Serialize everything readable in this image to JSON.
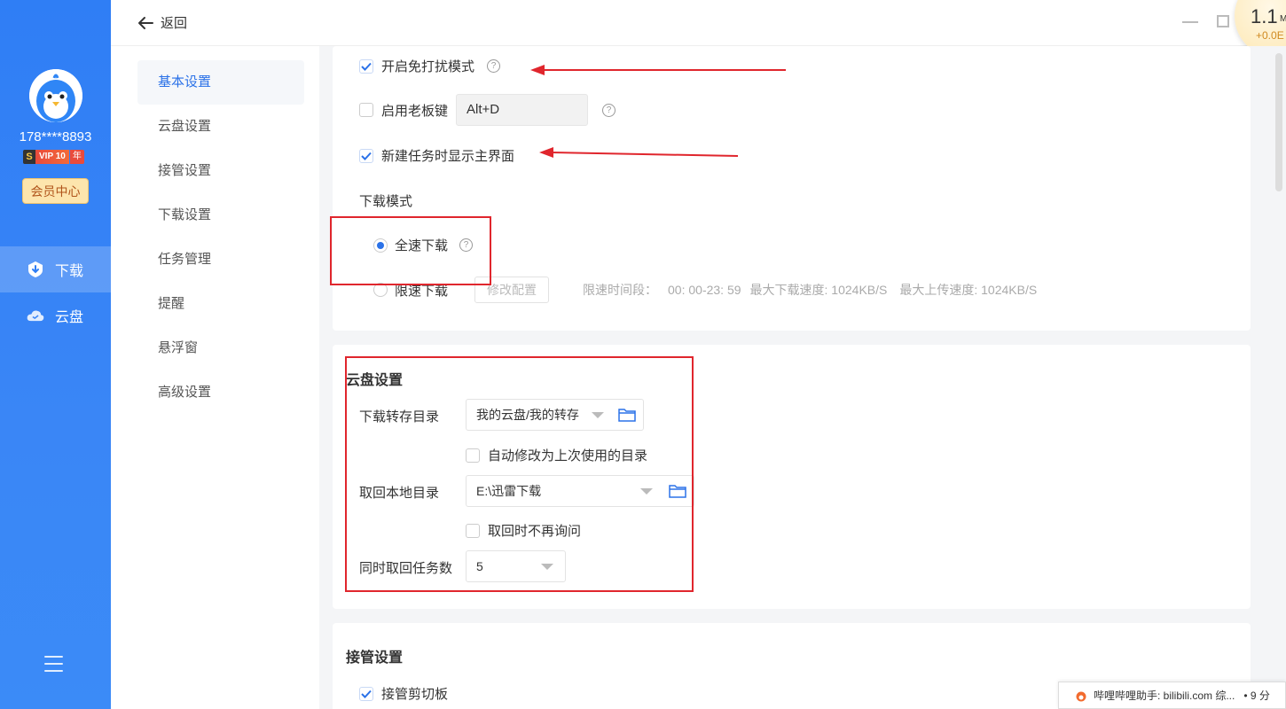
{
  "sidebar": {
    "username": "178****8893",
    "vip_prefix": "S",
    "vip_label": "VIP 10",
    "vip_suffix": "年",
    "member_center": "会员中心",
    "nav": [
      {
        "label": "下载",
        "icon": "download-shield-icon",
        "active": true
      },
      {
        "label": "云盘",
        "icon": "cloud-icon",
        "active": false
      }
    ]
  },
  "topbar": {
    "back_label": "返回"
  },
  "float_ball": {
    "speed": "1.1",
    "unit": "M",
    "sub": "+0.0E"
  },
  "settings_menu": [
    "基本设置",
    "云盘设置",
    "接管设置",
    "下载设置",
    "任务管理",
    "提醒",
    "悬浮窗",
    "高级设置"
  ],
  "basic": {
    "dnd_label": "开启免打扰模式",
    "dnd_checked": true,
    "boss_key_label": "启用老板键",
    "boss_key_value": "Alt+D",
    "boss_key_checked": false,
    "show_main_label": "新建任务时显示主界面",
    "show_main_checked": true,
    "download_mode_title": "下载模式",
    "full_speed_label": "全速下载",
    "limited_label": "限速下载",
    "modify_config": "修改配置",
    "limit_period_label": "限速时间段：",
    "limit_period_value": "00: 00-23: 59",
    "max_download": "最大下载速度: 1024KB/S",
    "max_upload": "最大上传速度: 1024KB/S"
  },
  "cloud": {
    "title": "云盘设置",
    "transfer_dir_label": "下载转存目录",
    "transfer_dir_value": "我的云盘/我的转存",
    "auto_modify_label": "自动修改为上次使用的目录",
    "local_dir_label": "取回本地目录",
    "local_dir_value": "E:\\迅雷下载",
    "no_ask_label": "取回时不再询问",
    "concurrent_label": "同时取回任务数",
    "concurrent_value": "5"
  },
  "takeover": {
    "title": "接管设置",
    "clipboard_label": "接管剪切板",
    "clipboard_checked": true
  },
  "toast": {
    "text": "哔哩哔哩助手: bilibili.com 综...",
    "extra": "• 9 分"
  },
  "colors": {
    "sidebar_blue": "#2f7ef5",
    "accent_blue": "#2b72e8",
    "annotation_red": "#e0262d",
    "member_btn_bg": "#fde5ad"
  }
}
